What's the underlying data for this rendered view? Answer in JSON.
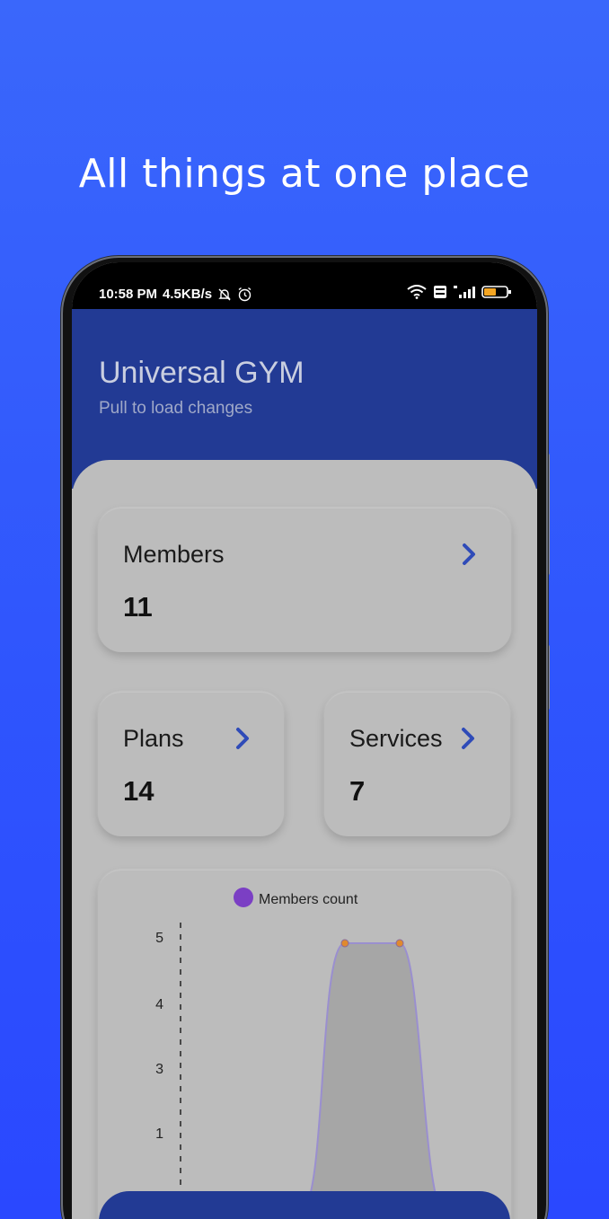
{
  "headline": "All things at one place",
  "status": {
    "time": "10:58 PM",
    "speed": "4.5KB/s",
    "battery": "48"
  },
  "app": {
    "title": "Universal GYM",
    "subtitle": "Pull to load changes"
  },
  "cards": {
    "members": {
      "label": "Members",
      "count": "11"
    },
    "plans": {
      "label": "Plans",
      "count": "14"
    },
    "services": {
      "label": "Services",
      "count": "7"
    }
  },
  "colors": {
    "accent": "#2f4bb8",
    "header": "#223a94",
    "series": "#7b3fc4",
    "point": "#e08a2e"
  },
  "chart_data": {
    "type": "area",
    "legend": [
      "Members count"
    ],
    "series": [
      {
        "name": "Members count",
        "x": [
          0,
          1,
          2,
          3,
          4
        ],
        "values": [
          0,
          0,
          5,
          5,
          0
        ]
      }
    ],
    "y_ticks": [
      "1",
      "3",
      "4",
      "5"
    ],
    "grid": false,
    "legend_position": "top-center"
  }
}
